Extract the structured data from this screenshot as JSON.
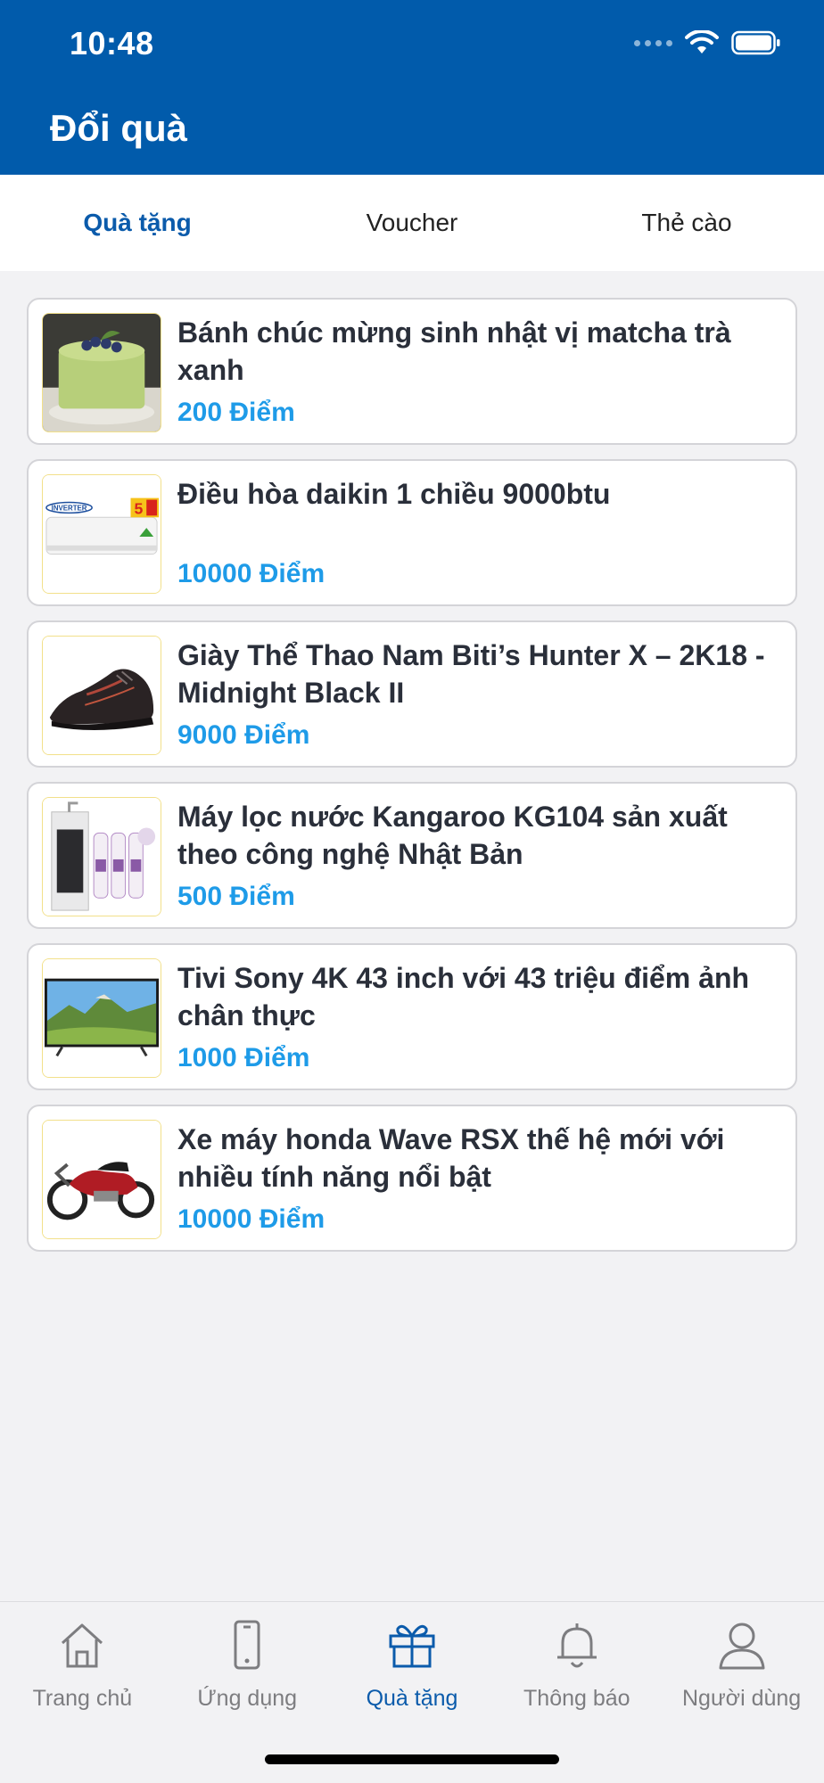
{
  "status_bar": {
    "time": "10:48"
  },
  "header": {
    "title": "Đổi quà",
    "bg_color": "#015bab"
  },
  "tabs": [
    {
      "label": "Quà tặng",
      "active": true
    },
    {
      "label": "Voucher",
      "active": false
    },
    {
      "label": "Thẻ cào",
      "active": false
    }
  ],
  "gifts": [
    {
      "title": "Bánh chúc mừng sinh nhật vị matcha trà xanh",
      "points": "200 Điểm",
      "image": "matcha-cake"
    },
    {
      "title": "Điều hòa daikin 1 chiều 9000btu",
      "points": "10000 Điểm",
      "image": "air-conditioner",
      "image_text": "INVERTER"
    },
    {
      "title": "Giày Thể Thao Nam Biti’s Hunter X – 2K18 - Midnight Black II",
      "points": "9000 Điểm",
      "image": "sneaker"
    },
    {
      "title": "Máy lọc nước Kangaroo KG104 sản xuất theo công nghệ Nhật Bản",
      "points": "500 Điểm",
      "image": "water-purifier"
    },
    {
      "title": "Tivi Sony 4K 43 inch với 43 triệu điểm ảnh chân thực",
      "points": "1000 Điểm",
      "image": "television"
    },
    {
      "title": "Xe máy honda Wave RSX thế hệ mới với nhiều tính năng nổi bật",
      "points": "10000 Điểm",
      "image": "motorbike"
    }
  ],
  "bottom_nav": [
    {
      "label": "Trang chủ",
      "icon": "home-icon",
      "active": false
    },
    {
      "label": "Ứng dụng",
      "icon": "phone-icon",
      "active": false
    },
    {
      "label": "Quà tặng",
      "icon": "gift-icon",
      "active": true
    },
    {
      "label": "Thông báo",
      "icon": "bell-icon",
      "active": false
    },
    {
      "label": "Người dùng",
      "icon": "user-icon",
      "active": false
    }
  ],
  "colors": {
    "accent": "#0b5bab",
    "points": "#1e9be8",
    "title_text": "#2a2f3a"
  }
}
